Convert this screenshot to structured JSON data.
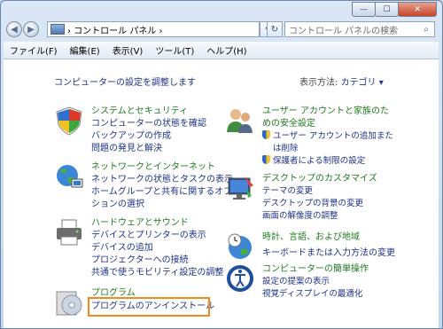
{
  "window": {
    "min_label": "—",
    "max_label": "☐",
    "close_label": "✕"
  },
  "address": {
    "path": "› コントロール パネル ›",
    "search_placeholder": "コントロール パネルの検索"
  },
  "menu": [
    "ファイル(F)",
    "編集(E)",
    "表示(V)",
    "ツール(T)",
    "ヘルプ(H)"
  ],
  "content": {
    "header": "コンピューターの設定を調整します",
    "view_by_label": "表示方法:",
    "view_by_value": "カテゴリ ▾"
  },
  "categories": {
    "system": {
      "title": "システムとセキュリティ",
      "links": [
        "コンピューターの状態を確認",
        "バックアップの作成",
        "問題の発見と解決"
      ]
    },
    "network": {
      "title": "ネットワークとインターネット",
      "links": [
        "ネットワークの状態とタスクの表示",
        "ホームグループと共有に関するオプ",
        "ションの選択"
      ]
    },
    "hardware": {
      "title": "ハードウェアとサウンド",
      "links": [
        "デバイスとプリンターの表示",
        "デバイスの追加",
        "プロジェクターへの接続",
        "共通で使うモビリティ設定の調整"
      ]
    },
    "programs": {
      "title": "プログラム",
      "links": [
        "プログラムのアンインストール"
      ]
    },
    "users": {
      "title": "ユーザー アカウントと家族のた",
      "title2": "めの安全設定",
      "links": [
        "ユーザー アカウントの追加また",
        "は削除",
        "保護者による制限の設定"
      ]
    },
    "appearance": {
      "title": "デスクトップのカスタマイズ",
      "links": [
        "テーマの変更",
        "デスクトップの背景の変更",
        "画面の解像度の調整"
      ]
    },
    "clock": {
      "title": "時計、言語、および地域",
      "links": [
        "キーボードまたは入力方法の変更"
      ]
    },
    "ease": {
      "title": "コンピューターの簡単操作",
      "links": [
        "設定の提案の表示",
        "視覚ディスプレイの最適化"
      ]
    }
  }
}
